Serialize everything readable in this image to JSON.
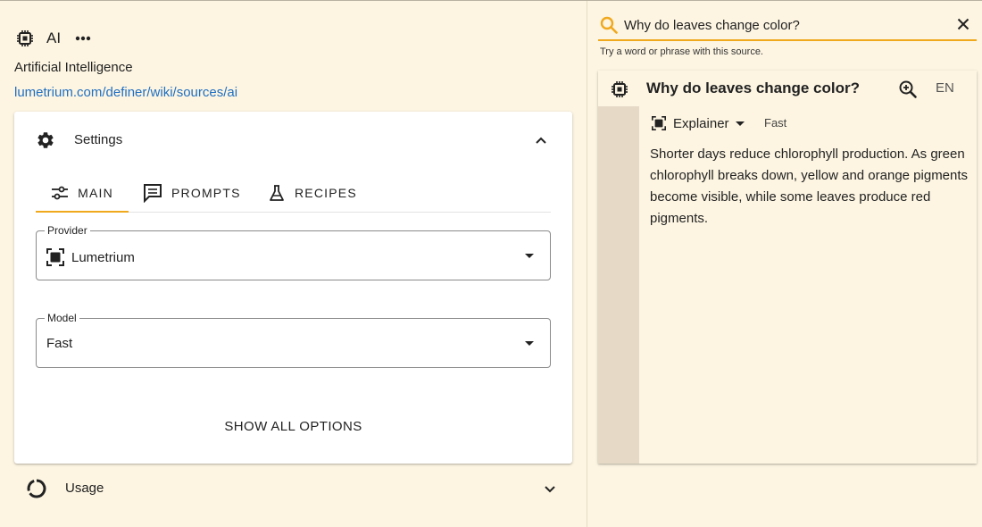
{
  "header": {
    "title": "AI",
    "subtitle": "Artificial Intelligence",
    "link": "lumetrium.com/definer/wiki/sources/ai"
  },
  "settings": {
    "label": "Settings",
    "tabs": [
      {
        "label": "MAIN",
        "icon": "sliders-icon"
      },
      {
        "label": "PROMPTS",
        "icon": "chat-icon"
      },
      {
        "label": "RECIPES",
        "icon": "flask-icon"
      }
    ],
    "provider": {
      "legend": "Provider",
      "value": "Lumetrium"
    },
    "model": {
      "legend": "Model",
      "value": "Fast"
    },
    "show_all": "SHOW ALL OPTIONS"
  },
  "usage": {
    "label": "Usage"
  },
  "search": {
    "value": "Why do leaves change color?",
    "hint": "Try a word or phrase with this source."
  },
  "result": {
    "question": "Why do leaves change color?",
    "lang": "EN",
    "mode": "Explainer",
    "speed": "Fast",
    "answer": "Shorter days reduce chlorophyll production. As green chlorophyll breaks down, yellow and orange pigments become visible, while some leaves produce red pigments."
  },
  "colors": {
    "background": "#fdf5e2",
    "accent": "#f0a81d",
    "link": "#1f6fc2",
    "sidebar": "#e6dac6"
  }
}
